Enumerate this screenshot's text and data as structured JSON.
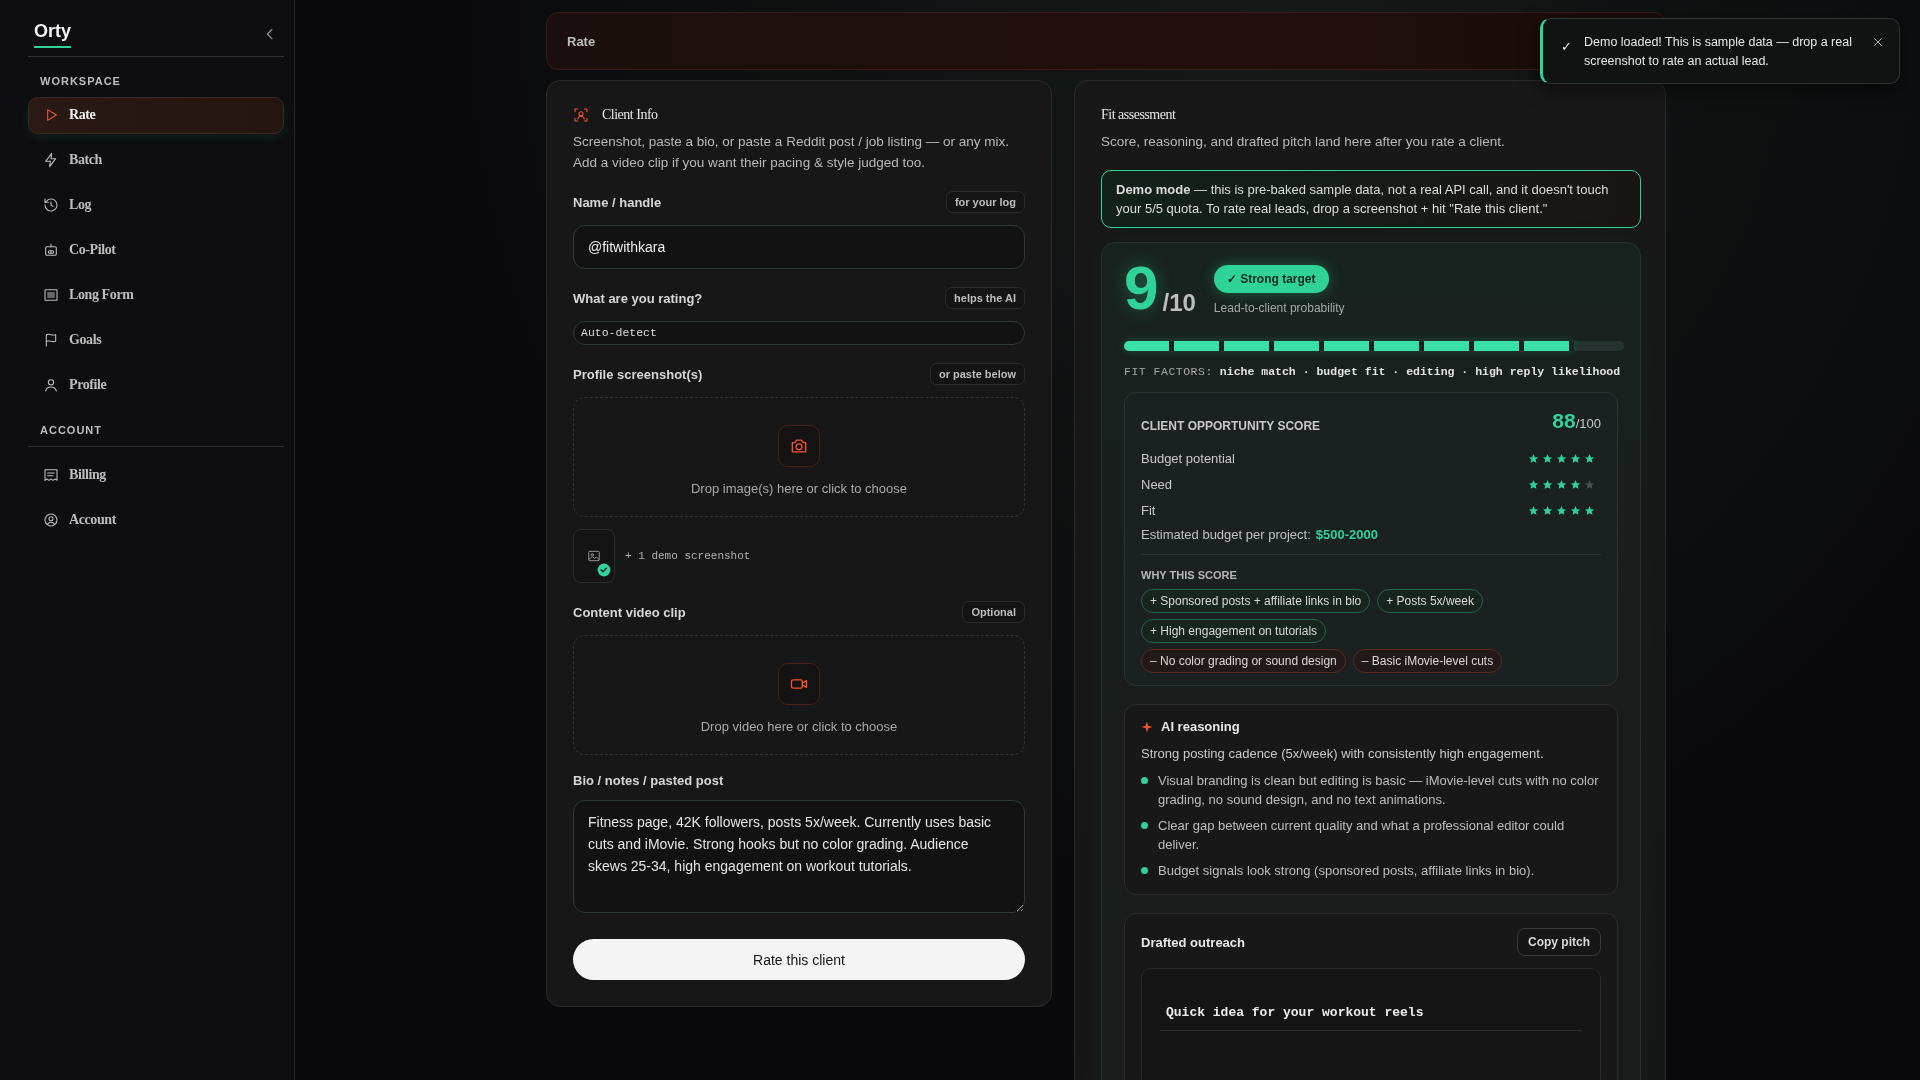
{
  "app": {
    "logo": "Orty"
  },
  "sidebar": {
    "sections": [
      {
        "title": "WORKSPACE",
        "items": [
          {
            "label": "Rate",
            "selected": true
          },
          {
            "label": "Batch",
            "selected": false
          },
          {
            "label": "Log",
            "selected": false
          },
          {
            "label": "Co-Pilot",
            "selected": false
          },
          {
            "label": "Long Form",
            "selected": false
          },
          {
            "label": "Goals",
            "selected": false
          },
          {
            "label": "Profile",
            "selected": false
          }
        ]
      },
      {
        "title": "ACCOUNT",
        "items": [
          {
            "label": "Billing",
            "selected": false
          },
          {
            "label": "Account",
            "selected": false
          }
        ]
      }
    ]
  },
  "topbar": {
    "title": "Rate"
  },
  "toast": {
    "check": "✓",
    "message": "Demo loaded! This is sample data — drop a real screenshot to rate an actual lead."
  },
  "client_info": {
    "title": "Client Info",
    "description": "Screenshot, paste a bio, or paste a Reddit post / job listing — or any mix. Add a video clip if you want their pacing & style judged too.",
    "name_field": {
      "label": "Name / handle",
      "hint": "for your log",
      "value": "@fitwithkara"
    },
    "rating_field": {
      "label": "What are you rating?",
      "hint": "helps the AI",
      "value": "Auto-detect"
    },
    "screenshots": {
      "label": "Profile screenshot(s)",
      "hint": "or paste below",
      "drop_text": "Drop image(s) here or click to choose",
      "attached": "+ 1 demo screenshot"
    },
    "video": {
      "label": "Content video clip",
      "hint": "Optional",
      "drop_text": "Drop video here or click to choose"
    },
    "bio": {
      "label": "Bio / notes / pasted post",
      "value": "Fitness page, 42K followers, posts 5x/week. Currently uses basic cuts and iMovie. Strong hooks but no color grading. Audience skews 25-34, high engagement on workout tutorials."
    },
    "submit": "Rate this client"
  },
  "fit_assessment": {
    "title": "Fit assessment",
    "description": "Score, reasoning, and drafted pitch land here after you rate a client.",
    "demo_note": "**Demo mode** — this is pre-baked sample data, not a real API call, and it doesn't touch your 5/5 quota. To rate real leads, drop a screenshot + hit \"Rate this client.\"",
    "score": {
      "value": "9",
      "scale": "/10",
      "badge": "✓ Strong target",
      "caption": "Lead-to-client probability",
      "level": 0.9,
      "factors_label": "FIT FACTORS:",
      "factors": "niche match · budget fit · editing · high reply likelihood"
    },
    "opportunity": {
      "title": "CLIENT OPPORTUNITY SCORE",
      "score": "88",
      "scale": "/100",
      "ratings": [
        {
          "label": "Budget potential",
          "stars": 5
        },
        {
          "label": "Need",
          "stars": 4
        },
        {
          "label": "Fit",
          "stars": 5
        }
      ],
      "budget_label": "Estimated budget per project:",
      "budget_value": "$500-2000",
      "why_title": "WHY THIS SCORE",
      "reasons": [
        {
          "text": "+ Sponsored posts + affiliate links in bio",
          "kind": "plus"
        },
        {
          "text": "+ Posts 5x/week",
          "kind": "plus"
        },
        {
          "text": "+ High engagement on tutorials",
          "kind": "plus"
        },
        {
          "text": "– No color grading or sound design",
          "kind": "minus"
        },
        {
          "text": "– Basic iMovie-level cuts",
          "kind": "minus"
        }
      ]
    },
    "reasoning": {
      "title": "AI reasoning",
      "summary": "Strong posting cadence (5x/week) with consistently high engagement.",
      "points": [
        "Visual branding is clean but editing is basic — iMovie-level cuts with no color grading, no sound design, and no text animations.",
        "Clear gap between current quality and what a professional editor could deliver.",
        "Budget signals look strong (sponsored posts, affiliate links in bio)."
      ]
    },
    "outreach": {
      "title": "Drafted outreach",
      "copy_button": "Copy pitch",
      "subject": "Quick idea for your workout reels"
    }
  }
}
